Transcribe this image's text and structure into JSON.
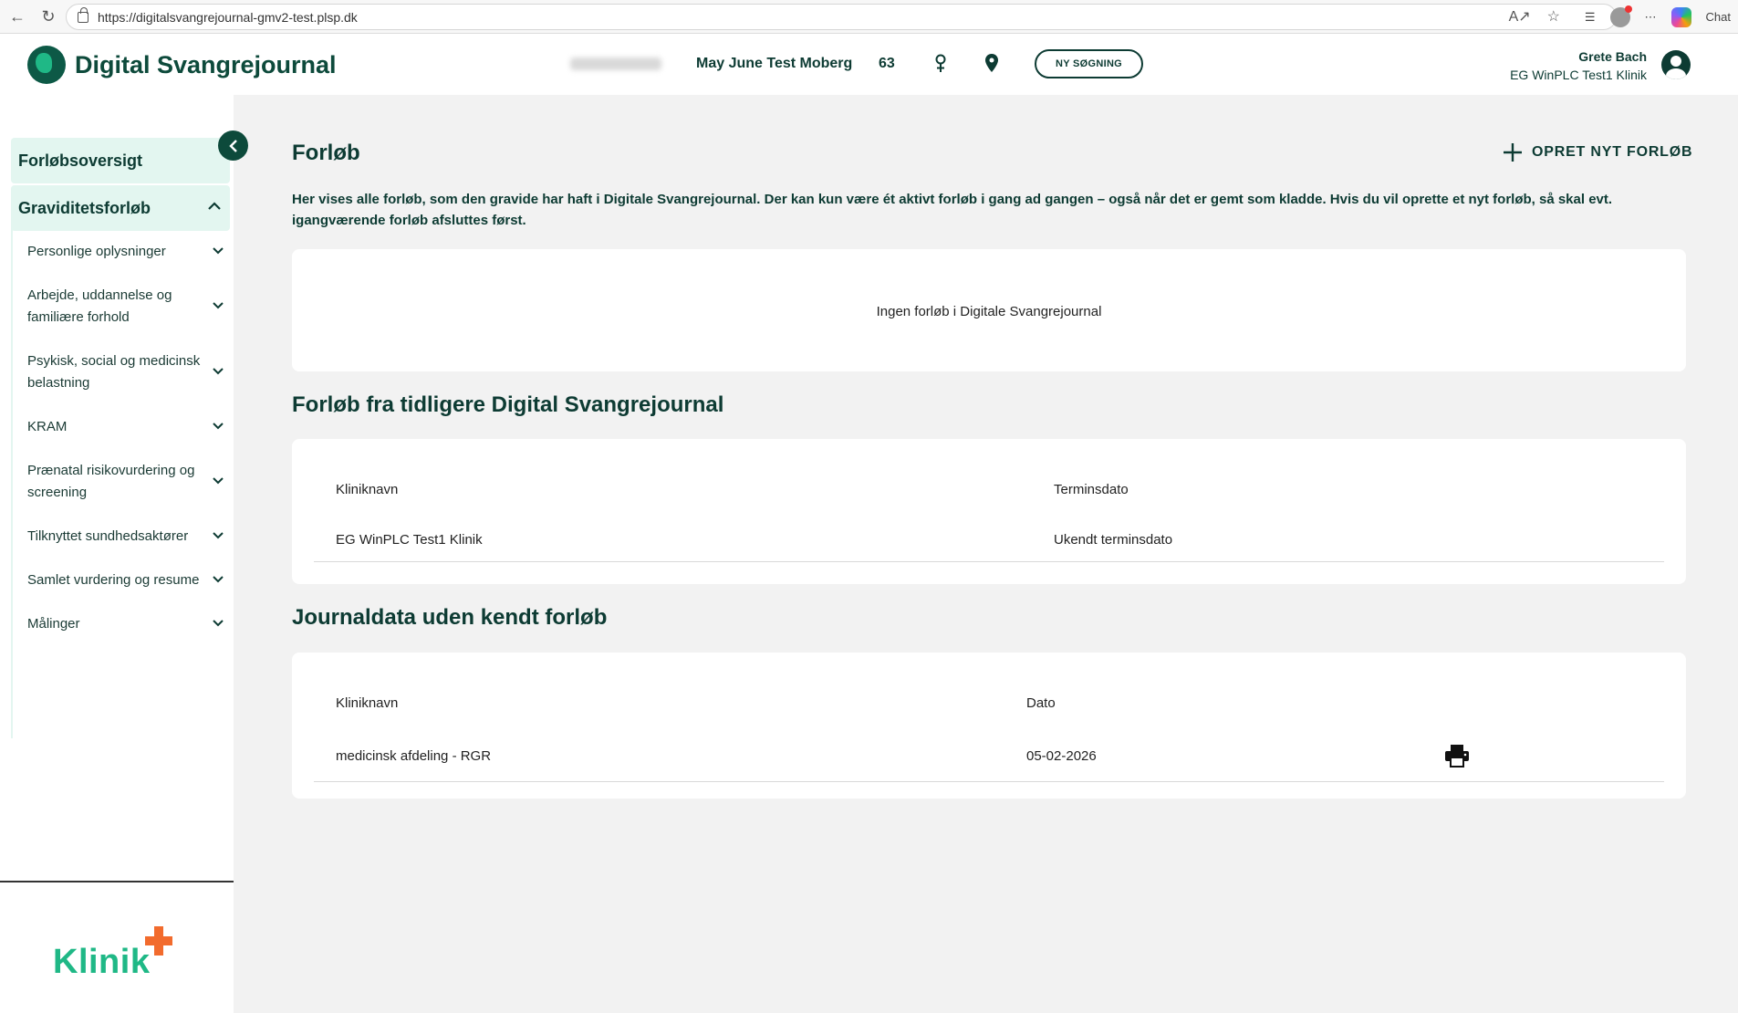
{
  "browser": {
    "url": "https://digitalsvangrejournal-gmv2-test.plsp.dk",
    "chat_label": "Chat"
  },
  "header": {
    "app_title": "Digital Svangrejournal",
    "patient_name": "May June Test Moberg",
    "patient_age": "63",
    "new_search_label": "NY SØGNING",
    "user_name": "Grete Bach",
    "user_clinic": "EG WinPLC Test1 Klinik"
  },
  "sidebar": {
    "overview_label": "Forløbsoversigt",
    "pregnancy_label": "Graviditetsforløb",
    "items": [
      {
        "label": "Personlige oplysninger"
      },
      {
        "label": "Arbejde, uddannelse og familiære forhold"
      },
      {
        "label": "Psykisk, social og medicinsk belastning"
      },
      {
        "label": "KRAM"
      },
      {
        "label": "Prænatal risikovurdering og screening"
      },
      {
        "label": "Tilknyttet sundhedsaktører"
      },
      {
        "label": "Samlet vurdering og resume"
      },
      {
        "label": "Målinger"
      }
    ],
    "logo_text": "Klinik"
  },
  "main": {
    "title": "Forløb",
    "create_label": "OPRET NYT FORLØB",
    "intro": "Her vises alle forløb, som den gravide har haft i Digitale Svangrejournal. Der kan kun være ét aktivt forløb i gang ad gangen – også når det er gemt som kladde. Hvis du vil oprette et nyt forløb, så skal evt. igangværende forløb afsluttes først.",
    "empty_text": "Ingen forløb i Digitale Svangrejournal",
    "previous": {
      "title": "Forløb fra tidligere Digital Svangrejournal",
      "headers": [
        "Kliniknavn",
        "Terminsdato"
      ],
      "rows": [
        [
          "EG WinPLC Test1 Klinik",
          "Ukendt terminsdato"
        ]
      ]
    },
    "unknown": {
      "title": "Journaldata uden kendt forløb",
      "headers": [
        "Kliniknavn",
        "Dato"
      ],
      "rows": [
        [
          "medicinsk afdeling - RGR",
          "05-02-2026"
        ]
      ]
    }
  },
  "colors": {
    "brand_dark": "#0d3b33",
    "brand_green": "#1fb886",
    "accent_orange": "#f26b2d",
    "active_bg": "#e3f6f0"
  }
}
